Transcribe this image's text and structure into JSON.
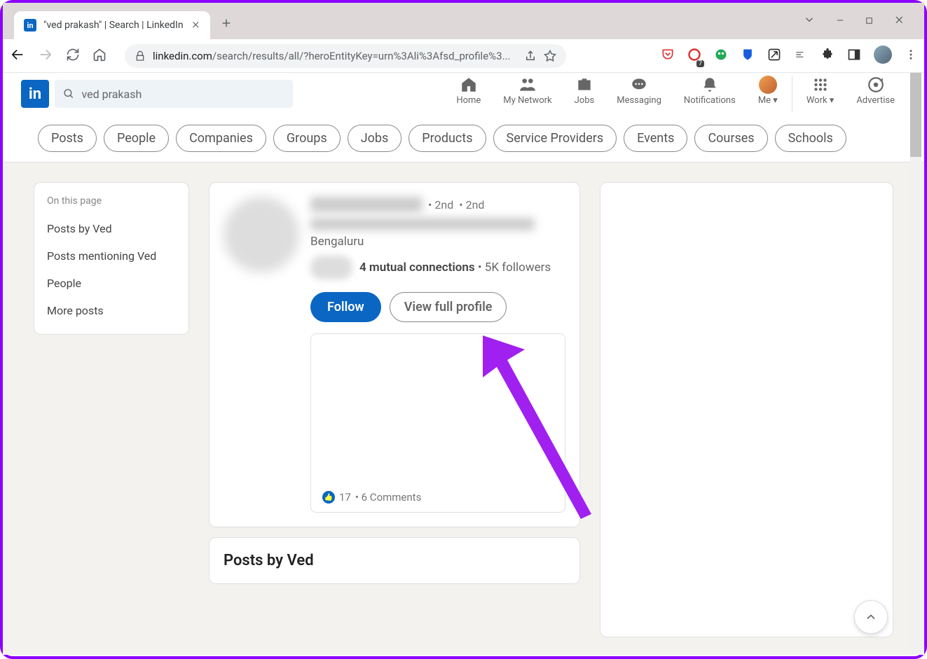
{
  "browser": {
    "tab_title": "\"ved prakash\" | Search | LinkedIn",
    "url_domain": "linkedin.com",
    "url_path": "/search/results/all/?heroEntityKey=urn%3Ali%3Afsd_profile%3..."
  },
  "linkedin": {
    "search_value": "ved prakash",
    "nav": {
      "home": "Home",
      "network": "My Network",
      "jobs": "Jobs",
      "messaging": "Messaging",
      "notifications": "Notifications",
      "me": "Me",
      "work": "Work",
      "advertise": "Advertise"
    },
    "filters": [
      "Posts",
      "People",
      "Companies",
      "Groups",
      "Jobs",
      "Products",
      "Service Providers",
      "Events",
      "Courses",
      "Schools"
    ],
    "sidebar": {
      "heading": "On this page",
      "links": [
        "Posts by Ved",
        "Posts mentioning Ved",
        "People",
        "More posts"
      ]
    },
    "result": {
      "degree1": "• 2nd",
      "degree2": "• 2nd",
      "location": "Bengaluru",
      "mutual_bold": "4 mutual connections",
      "mutual_rest": " • 5K followers",
      "follow_btn": "Follow",
      "view_btn": "View full profile",
      "likes": "17",
      "comments": "• 6 Comments"
    },
    "posts_section_title": "Posts by Ved"
  }
}
